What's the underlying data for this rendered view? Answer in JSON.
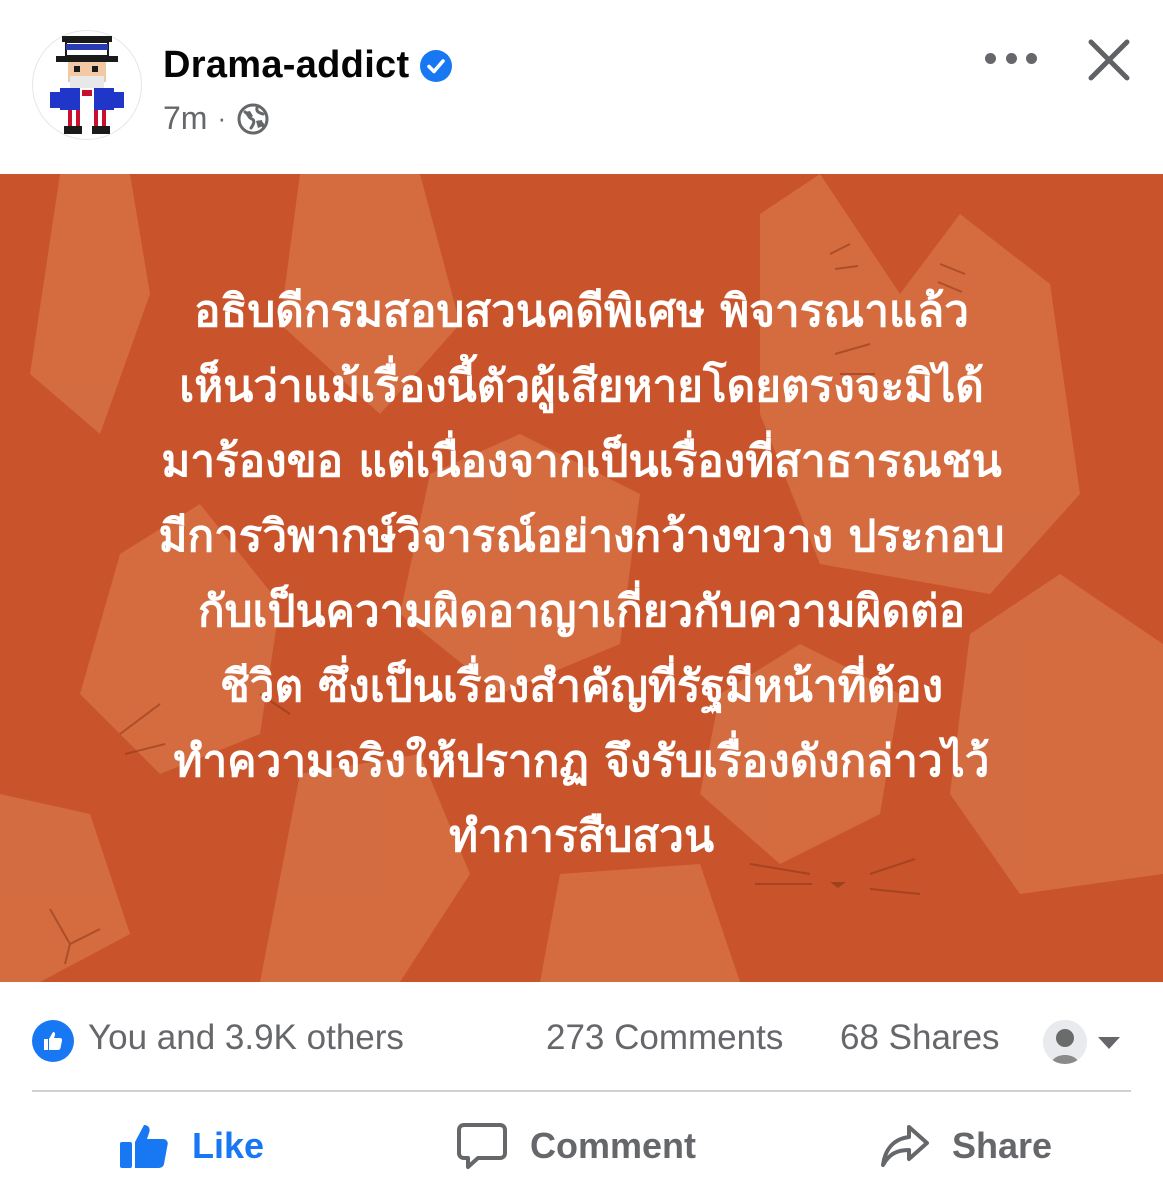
{
  "header": {
    "page_name": "Drama-addict",
    "verified_icon": "verified-badge-icon",
    "timestamp": "7m",
    "separator": "·",
    "audience_icon": "globe-icon",
    "more_icon": "more-horizontal-icon",
    "close_icon": "close-icon"
  },
  "post": {
    "background_color": "#c9532a",
    "text_color": "#ffffff",
    "lines": [
      "อธิบดีกรมสอบสวนคดีพิเศษ พิจารณาแล้ว",
      "เห็นว่าแม้เรื่องนี้ตัวผู้เสียหายโดยตรงจะมิได้",
      "มาร้องขอ แต่เนื่องจากเป็นเรื่องที่สาธารณชน",
      "มีการวิพากษ์วิจารณ์อย่างกว้างขวาง ประกอบ",
      "กับเป็นความผิดอาญาเกี่ยวกับความผิดต่อ",
      "ชีวิต ซึ่งเป็นเรื่องสำคัญที่รัฐมีหน้าที่ต้อง",
      "ทำความจริงให้ปรากฏ จึงรับเรื่องดังกล่าวไว้",
      "ทำการสืบสวน"
    ]
  },
  "stats": {
    "reactions": "You and 3.9K others",
    "comments": "273 Comments",
    "shares": "68 Shares",
    "reaction_icon": "like-reaction-icon",
    "viewer_avatar": "viewer-avatar",
    "caret_icon": "caret-down-icon"
  },
  "actions": {
    "like": "Like",
    "comment": "Comment",
    "share": "Share"
  },
  "colors": {
    "brand_blue": "#1877f2",
    "secondary_text": "#65676b",
    "divider": "#ced0d4"
  }
}
